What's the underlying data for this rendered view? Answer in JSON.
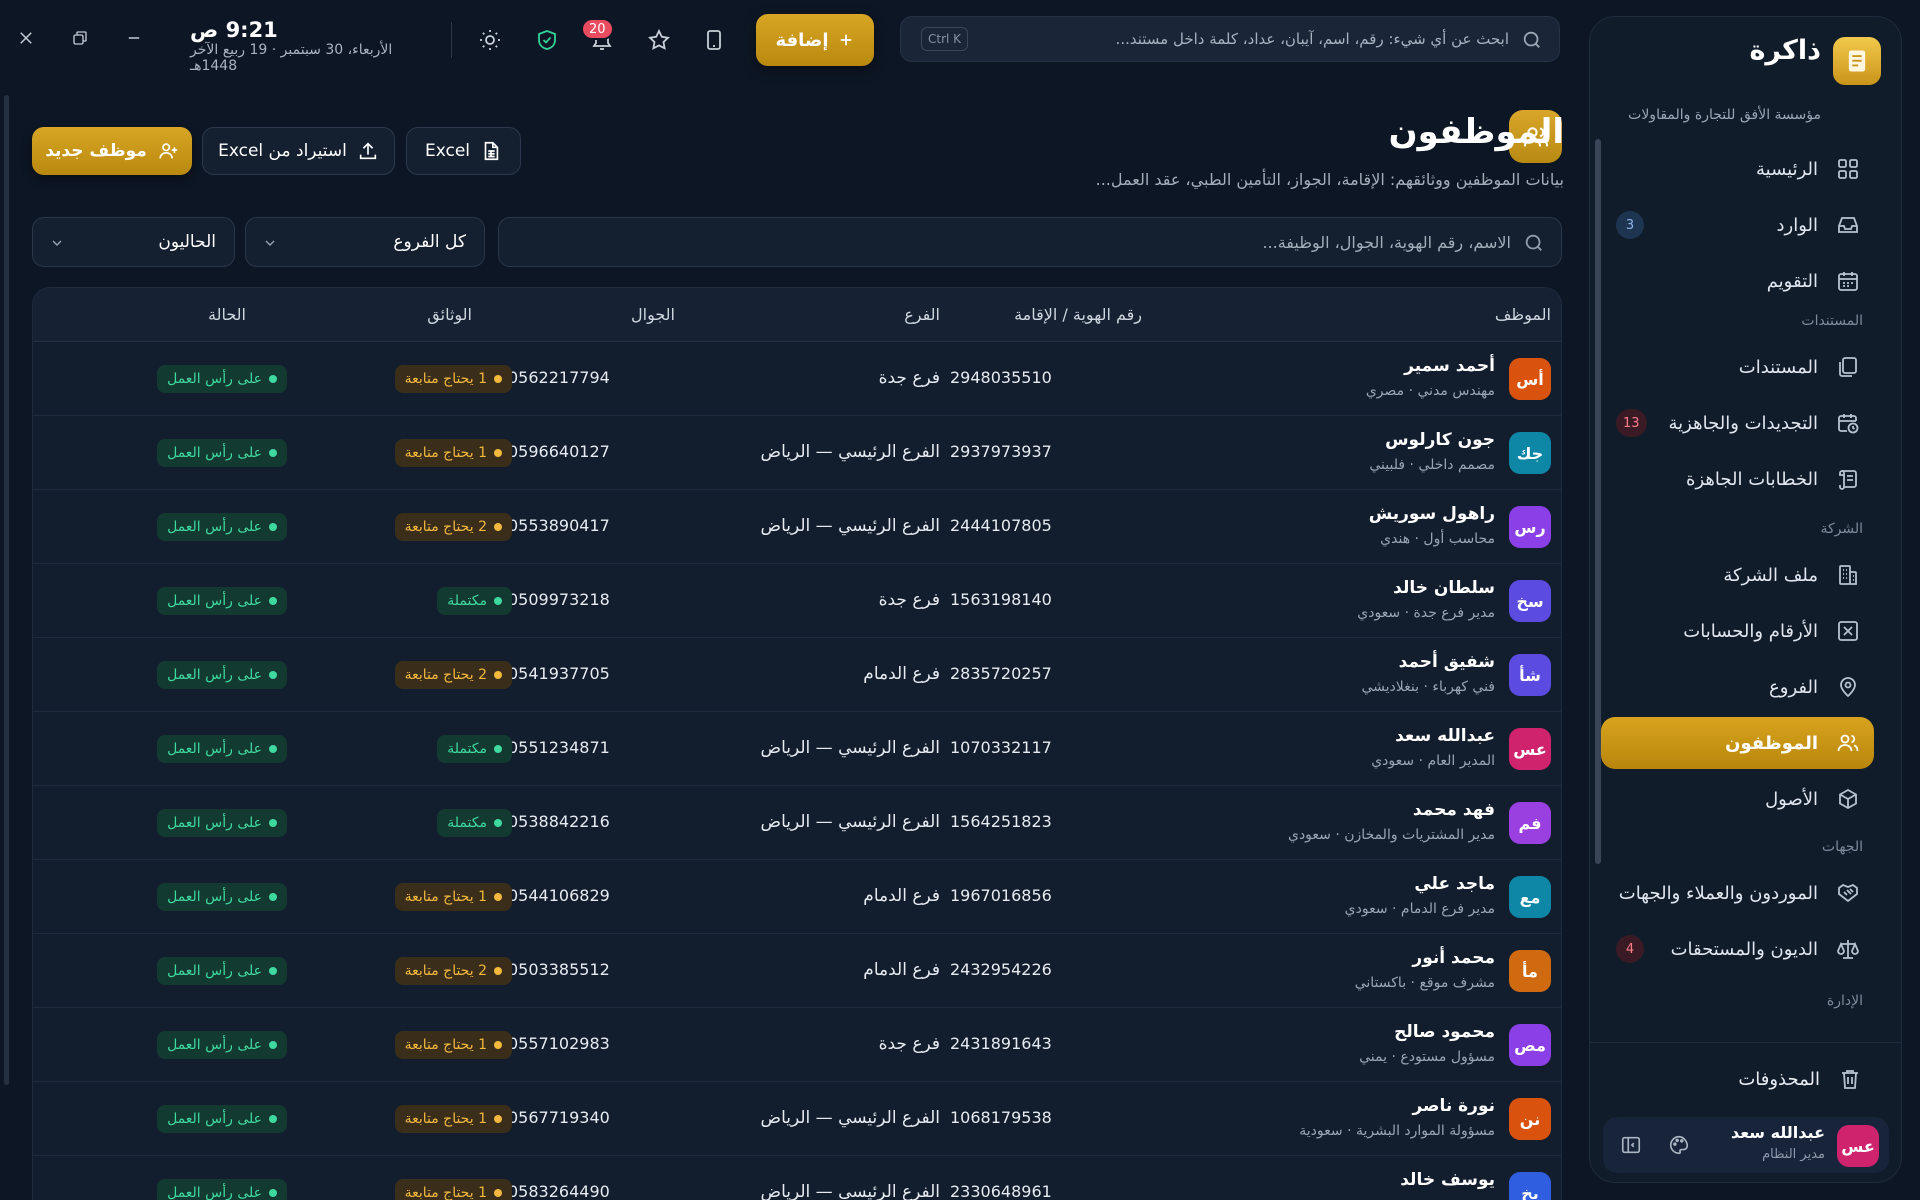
{
  "app": {
    "name": "ذاكرة",
    "org": "مؤسسة الأفق للتجارة والمقاولات"
  },
  "topbar": {
    "time": "9:21 ص",
    "date": "الأربعاء، 30 سبتمبر · 19 ربيع الآخر 1448هـ",
    "notifications_count": "20",
    "add_label": "إضافة",
    "search_placeholder": "ابحث عن أي شيء: رقم، اسم، آيبان، عداد، كلمة داخل مستند...",
    "search_shortcut": "Ctrl K"
  },
  "sidebar": {
    "items": [
      {
        "label": "الرئيسية",
        "icon": "grid-icon"
      },
      {
        "label": "الوارد",
        "icon": "inbox-icon",
        "badge": "3"
      },
      {
        "label": "التقويم",
        "icon": "calendar-icon"
      },
      {
        "section": "المستندات"
      },
      {
        "label": "المستندات",
        "icon": "documents-icon"
      },
      {
        "label": "التجديدات والجاهزية",
        "icon": "calendar-clock-icon",
        "badge": "13"
      },
      {
        "label": "الخطابات الجاهزة",
        "icon": "scroll-icon"
      },
      {
        "section": "الشركة"
      },
      {
        "label": "ملف الشركة",
        "icon": "building-icon"
      },
      {
        "label": "الأرقام والحسابات",
        "icon": "calculator-icon"
      },
      {
        "label": "الفروع",
        "icon": "map-pin-icon"
      },
      {
        "label": "الموظفون",
        "icon": "users-icon",
        "active": true
      },
      {
        "label": "الأصول",
        "icon": "box-icon"
      },
      {
        "section": "الجهات"
      },
      {
        "label": "الموردون والعملاء والجهات",
        "icon": "handshake-icon"
      },
      {
        "label": "الديون والمستحقات",
        "icon": "scale-icon",
        "badge": "4"
      },
      {
        "section": "الإدارة"
      }
    ],
    "trash_label": "المحذوفات",
    "user": {
      "initials": "عس",
      "name": "عبدالله سعد",
      "role": "مدير النظام"
    }
  },
  "page": {
    "title": "الموظفون",
    "subtitle": "بيانات الموظفين ووثائقهم: الإقامة، الجواز، التأمين الطبي، عقد العمل...",
    "btn_new": "موظف جديد",
    "btn_import": "استيراد من Excel",
    "btn_export": "Excel",
    "filter_placeholder": "الاسم، رقم الهوية، الجوال، الوظيفة...",
    "branch_filter": "كل الفروع",
    "status_filter": "الحاليون"
  },
  "table": {
    "columns": [
      "الموظف",
      "رقم الهوية / الإقامة",
      "الفرع",
      "الجوال",
      "الوثائق",
      "الحالة"
    ],
    "rows": [
      {
        "initials": "أس",
        "color": "#d9530f",
        "name": "أحمد سمير",
        "role": "مهندس مدني · مصري",
        "id": "2948035510",
        "branch": "فرع جدة",
        "phone": "0562217794",
        "docs": "1 يحتاج متابعة",
        "docs_state": "warn",
        "status": "على رأس العمل"
      },
      {
        "initials": "جك",
        "color": "#0e86a6",
        "name": "جون كارلوس",
        "role": "مصمم داخلي · فلبيني",
        "id": "2937973937",
        "branch": "الفرع الرئيسي — الرياض",
        "phone": "0596640127",
        "docs": "1 يحتاج متابعة",
        "docs_state": "warn",
        "status": "على رأس العمل"
      },
      {
        "initials": "رس",
        "color": "#8b3fe6",
        "name": "راهول سوريش",
        "role": "محاسب أول · هندي",
        "id": "2444107805",
        "branch": "الفرع الرئيسي — الرياض",
        "phone": "0553890417",
        "docs": "2 يحتاج متابعة",
        "docs_state": "warn",
        "status": "على رأس العمل"
      },
      {
        "initials": "سخ",
        "color": "#5b4be0",
        "name": "سلطان خالد",
        "role": "مدير فرع جدة · سعودي",
        "id": "1563198140",
        "branch": "فرع جدة",
        "phone": "0509973218",
        "docs": "مكتملة",
        "docs_state": "ok",
        "status": "على رأس العمل"
      },
      {
        "initials": "شأ",
        "color": "#5b4be0",
        "name": "شفيق أحمد",
        "role": "فني كهرباء · بنغلاديشي",
        "id": "2835720257",
        "branch": "فرع الدمام",
        "phone": "0541937705",
        "docs": "2 يحتاج متابعة",
        "docs_state": "warn",
        "status": "على رأس العمل"
      },
      {
        "initials": "عس",
        "color": "#d0236e",
        "name": "عبدالله سعد",
        "role": "المدير العام · سعودي",
        "id": "1070332117",
        "branch": "الفرع الرئيسي — الرياض",
        "phone": "0551234871",
        "docs": "مكتملة",
        "docs_state": "ok",
        "status": "على رأس العمل"
      },
      {
        "initials": "فم",
        "color": "#9a3fe0",
        "name": "فهد محمد",
        "role": "مدير المشتريات والمخازن · سعودي",
        "id": "1564251823",
        "branch": "الفرع الرئيسي — الرياض",
        "phone": "0538842216",
        "docs": "مكتملة",
        "docs_state": "ok",
        "status": "على رأس العمل"
      },
      {
        "initials": "مع",
        "color": "#0e86a6",
        "name": "ماجد علي",
        "role": "مدير فرع الدمام · سعودي",
        "id": "1967016856",
        "branch": "فرع الدمام",
        "phone": "0544106829",
        "docs": "1 يحتاج متابعة",
        "docs_state": "warn",
        "status": "على رأس العمل"
      },
      {
        "initials": "مأ",
        "color": "#cf6a10",
        "name": "محمد أنور",
        "role": "مشرف موقع · باكستاني",
        "id": "2432954226",
        "branch": "فرع الدمام",
        "phone": "0503385512",
        "docs": "2 يحتاج متابعة",
        "docs_state": "warn",
        "status": "على رأس العمل"
      },
      {
        "initials": "مص",
        "color": "#8b3fe6",
        "name": "محمود صالح",
        "role": "مسؤول مستودع · يمني",
        "id": "2431891643",
        "branch": "فرع جدة",
        "phone": "0557102983",
        "docs": "1 يحتاج متابعة",
        "docs_state": "warn",
        "status": "على رأس العمل"
      },
      {
        "initials": "نن",
        "color": "#d9530f",
        "name": "نورة ناصر",
        "role": "مسؤولة الموارد البشرية · سعودية",
        "id": "1068179538",
        "branch": "الفرع الرئيسي — الرياض",
        "phone": "0567719340",
        "docs": "1 يحتاج متابعة",
        "docs_state": "warn",
        "status": "على رأس العمل"
      },
      {
        "initials": "يخ",
        "color": "#2f5fe0",
        "name": "يوسف خالد",
        "role": "",
        "id": "2330648961",
        "branch": "الفرع الرئيسي — الرياض",
        "phone": "0583264490",
        "docs": "1 يحتاج متابعة",
        "docs_state": "warn",
        "status": "على رأس العمل"
      }
    ]
  },
  "colors": {
    "accent": "#d8a624",
    "background": "#0d1624",
    "ok": "#3fd9a0",
    "warn": "#f3b83e",
    "danger": "#e94b5f"
  }
}
